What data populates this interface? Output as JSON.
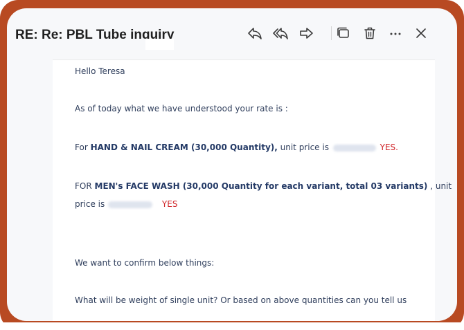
{
  "header": {
    "subject": "RE: Re: PBL Tube inquiry"
  },
  "toolbar": {
    "icons": [
      "reply-icon",
      "reply-all-icon",
      "forward-icon",
      "popout-icon",
      "delete-icon",
      "more-icon",
      "close-icon"
    ]
  },
  "message": {
    "greeting": "Hello Teresa",
    "intro": "As of today what we have understood your rate is :",
    "line1": {
      "prefix": "For ",
      "product": "HAND & NAIL CREAM (30,000 Quantity),",
      "price_label": " unit price is",
      "confirm": "YES."
    },
    "line2": {
      "prefix": "FOR ",
      "product": "MEN's FACE WASH (30,000 Quantity for each variant, total 03 variants)",
      "suffix": " , unit",
      "price_label": "price is",
      "confirm": "YES"
    },
    "confirm_intro": "We want to confirm below things:",
    "question": "What will be weight of single unit? Or based on above quantities can you tell us"
  },
  "colors": {
    "frame": "#b84a22",
    "window_bg": "#f7f8fa",
    "text": "#2f3e5c",
    "accent_bold": "#243a66",
    "yes_red": "#d0262a"
  }
}
